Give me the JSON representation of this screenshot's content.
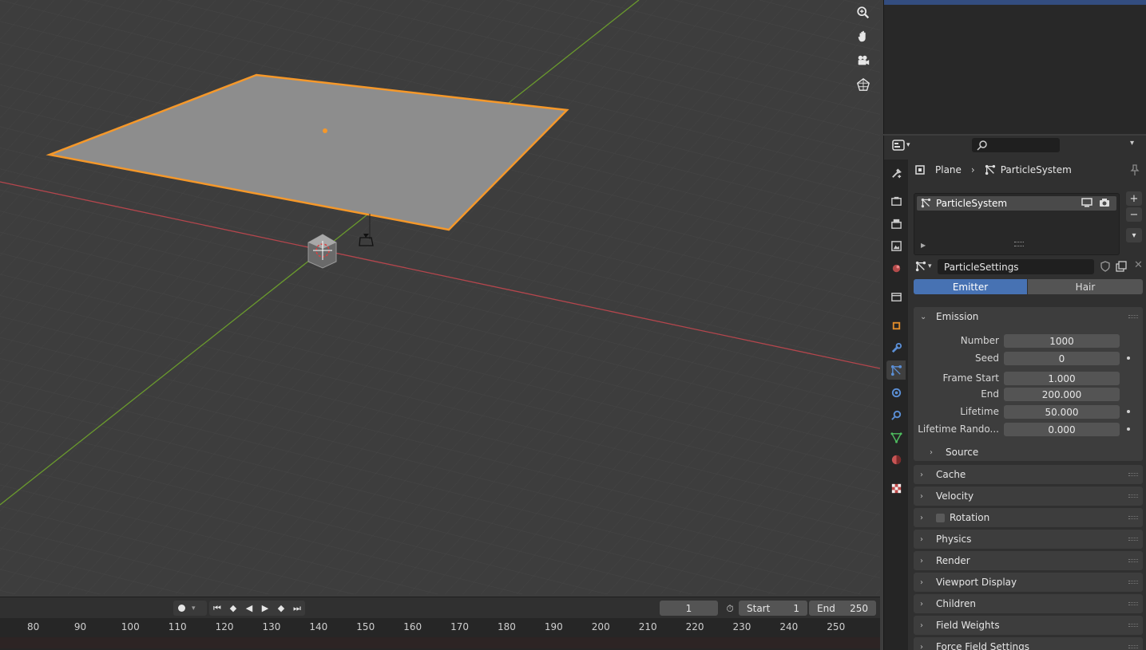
{
  "colors": {
    "viewport_bg": "#3d3d3d",
    "selection_outline": "#f5982a",
    "x_axis": "#b5464d",
    "y_axis": "#6a9a2d",
    "accent_active": "#4772b3"
  },
  "viewport": {
    "nav_icons": [
      "zoom-icon",
      "pan-hand-icon",
      "camera-view-icon",
      "ortho-grid-icon"
    ]
  },
  "timeline": {
    "current_frame": "1",
    "start_label": "Start",
    "start_value": "1",
    "end_label": "End",
    "end_value": "250",
    "ticks": [
      "80",
      "90",
      "100",
      "110",
      "120",
      "130",
      "140",
      "150",
      "160",
      "170",
      "180",
      "190",
      "200",
      "210",
      "220",
      "230",
      "240",
      "250"
    ]
  },
  "properties": {
    "breadcrumb": {
      "object": "Plane",
      "data": "ParticleSystem"
    },
    "particle_list": {
      "item": "ParticleSystem"
    },
    "settings_name": "ParticleSettings",
    "type_tabs": {
      "emitter": "Emitter",
      "hair": "Hair"
    },
    "emission": {
      "title": "Emission",
      "fields": [
        {
          "label": "Number",
          "value": "1000"
        },
        {
          "label": "Seed",
          "value": "0"
        },
        {
          "label": "Frame Start",
          "value": "1.000"
        },
        {
          "label": "End",
          "value": "200.000"
        },
        {
          "label": "Lifetime",
          "value": "50.000"
        },
        {
          "label": "Lifetime Rando...",
          "value": "0.000"
        }
      ],
      "source_label": "Source"
    },
    "panels": [
      "Cache",
      "Velocity",
      "Rotation",
      "Physics",
      "Render",
      "Viewport Display",
      "Children",
      "Field Weights",
      "Force Field Settings"
    ]
  }
}
